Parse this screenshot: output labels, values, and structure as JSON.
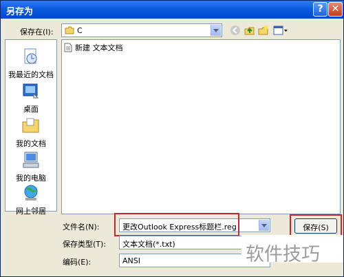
{
  "window": {
    "title": "另存为",
    "help_glyph": "?",
    "close_glyph": "✕"
  },
  "save_in": {
    "label": "保存在(I):",
    "value": "C"
  },
  "places": [
    {
      "label": "我最近的文档",
      "icon": "recent-documents-icon"
    },
    {
      "label": "桌面",
      "icon": "desktop-icon"
    },
    {
      "label": "我的文档",
      "icon": "my-documents-icon"
    },
    {
      "label": "我的电脑",
      "icon": "my-computer-icon"
    },
    {
      "label": "网上邻居",
      "icon": "network-places-icon"
    }
  ],
  "files": [
    {
      "name": "新建 文本文档",
      "icon": "text-file-icon"
    }
  ],
  "filename": {
    "label": "文件名(N):",
    "value": "更改Outlook Express标题栏.reg"
  },
  "filetype": {
    "label": "保存类型(T):",
    "value": "文本文档(*.txt)"
  },
  "encoding": {
    "label": "编码(E):",
    "value": "ANSI"
  },
  "buttons": {
    "save": "保存(S)"
  },
  "watermark": {
    "text": "软件技巧"
  },
  "colors": {
    "highlight_box": "#c6262e",
    "titlebar": "#0a5ce0"
  }
}
